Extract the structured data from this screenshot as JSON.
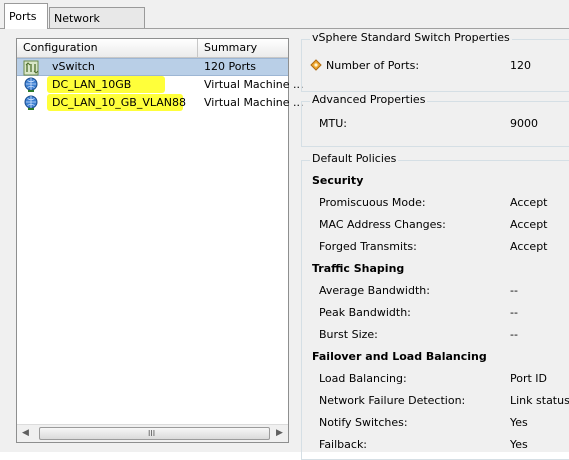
{
  "tabs": [
    {
      "label": "Ports",
      "active": true
    },
    {
      "label": "Network Adapters",
      "active": false
    }
  ],
  "table": {
    "columns": [
      "Configuration",
      "Summary"
    ],
    "rows": [
      {
        "name": "vSwitch",
        "summary": "120 Ports",
        "icon": "vswitch-icon",
        "selected": true
      },
      {
        "name": "DC_LAN_10GB",
        "summary": "Virtual Machine ...",
        "icon": "port-group-icon",
        "highlighted": true
      },
      {
        "name": "DC_LAN_10_GB_VLAN88",
        "summary": "Virtual Machine ...",
        "icon": "port-group-icon",
        "highlighted": true
      }
    ],
    "scroll_grip": "III"
  },
  "vswitch_props": {
    "legend": "vSphere Standard Switch Properties",
    "ports_label": "Number of Ports:",
    "ports_value": "120"
  },
  "advanced": {
    "legend": "Advanced Properties",
    "mtu_label": "MTU:",
    "mtu_value": "9000"
  },
  "policies": {
    "legend": "Default Policies",
    "security": {
      "title": "Security",
      "items": [
        {
          "label": "Promiscuous Mode:",
          "value": "Accept"
        },
        {
          "label": "MAC Address Changes:",
          "value": "Accept"
        },
        {
          "label": "Forged Transmits:",
          "value": "Accept"
        }
      ]
    },
    "shaping": {
      "title": "Traffic Shaping",
      "items": [
        {
          "label": "Average Bandwidth:",
          "value": "--"
        },
        {
          "label": "Peak Bandwidth:",
          "value": "--"
        },
        {
          "label": "Burst Size:",
          "value": "--"
        }
      ]
    },
    "failover": {
      "title": "Failover and Load Balancing",
      "items": [
        {
          "label": "Load Balancing:",
          "value": "Port ID"
        },
        {
          "label": "Network Failure Detection:",
          "value": "Link status o"
        },
        {
          "label": "Notify Switches:",
          "value": "Yes"
        },
        {
          "label": "Failback:",
          "value": "Yes"
        }
      ]
    }
  },
  "colors": {
    "selection": "#b9cfe7",
    "highlight": "#ffff3a"
  }
}
